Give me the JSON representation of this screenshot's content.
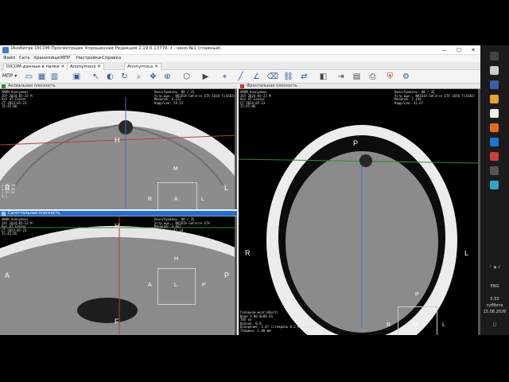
{
  "window": {
    "title": "Инобитек DICOM-Просмотрщик Упрощенная Редакция 2.19.0.13776 -r - окно №1 (главный)",
    "minimize": "—",
    "maximize": "☐",
    "close": "✕"
  },
  "menu": [
    "Файл",
    "Сеть",
    "Хранилище",
    "МПР",
    "Настройки",
    "Справка"
  ],
  "tabs": [
    "DICOM-данные в папке",
    "Anonymous",
    "Anonymous"
  ],
  "toolbar": {
    "mode_label": "МПР"
  },
  "viewports": {
    "axial": {
      "title": "Аксиальная плоскость",
      "overlay_tl": "ANON Anonymous\n26Y 2024-05-23 M\nAxt 4T Center\nCT 2024-05-23\n15:45:06",
      "overlay_tr": "Окно/Уровень: 80 / 35\nУстр.вых.: NVIDIA GeForce GTX 1650 Ti(D3D)\nМасштаб: 4.222\nКадр/сек: 59.32",
      "overlay_bl": "1.00 mm\n3.00 mm\n1.00 mm\n0.5",
      "orient": {
        "top": "H",
        "left": "R",
        "right": "L",
        "bottom": "F",
        "roi1": "R",
        "roi2": "A",
        "roi3": "L",
        "roi4": "F",
        "m": "M"
      }
    },
    "sagittal": {
      "title": "Сагиттальная плоскость",
      "overlay_tl": "ANON Anonymous\n26Y 2024-05-23 M\nAxt 4T Center\nCT 2024-05-23\n15:45:05",
      "overlay_tr": "Окно/Уровень: 80 / 35\nУстр.вых.: NVIDIA GeForce GTX\nМасштаб: 3.667\nКадр/сек: 42.34",
      "orient": {
        "top": "H",
        "left": "A",
        "right": "P",
        "bottom": "F",
        "roi1": "A",
        "roi2": "L",
        "roi3": "P",
        "roi4": "H"
      }
    },
    "frontal": {
      "title": "Фронтальная плоскость",
      "overlay_tl": "ANON Anonymous\n26Y 2024-05-23 M\nAxt 4T Center\nCT 2024-05-23\n15:45:06",
      "overlay_tr": "Окно/Уровень: 80 / 35\nУстр.вых.: NVIDIA GeForce GTX 1650 Ti(D3D)\nМасштаб: 2.194\nКадр/сек: 41.67",
      "overlay_bl": "Головной мозг(Adult)\nВзял 1.00 W=80 ES\nТОЛ ез\nКолонн. 0.0\nВсверкние: 1.07 с/спираль 0.2 мм/оборот\nТолщина: 1.00 мм",
      "orient": {
        "top": "P",
        "left": "R",
        "right": "L",
        "bottom": "A",
        "roi1": "P",
        "roi2": "R",
        "roi3": "H",
        "roi4": "L",
        "roi5": "A"
      }
    }
  },
  "taskbar": {
    "lang": "ENG",
    "time": "5:53",
    "day": "суббота",
    "date": "15.08.2026"
  },
  "colors": {
    "accent": "#1f6fd6",
    "brain": "#8f8f8f",
    "skull": "#ffffff"
  }
}
